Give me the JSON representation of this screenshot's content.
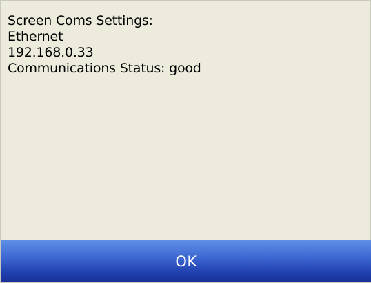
{
  "dialog": {
    "lines": [
      "Screen Coms Settings:",
      "Ethernet",
      "192.168.0.33",
      "Communications Status: good"
    ],
    "ok_label": "OK"
  }
}
